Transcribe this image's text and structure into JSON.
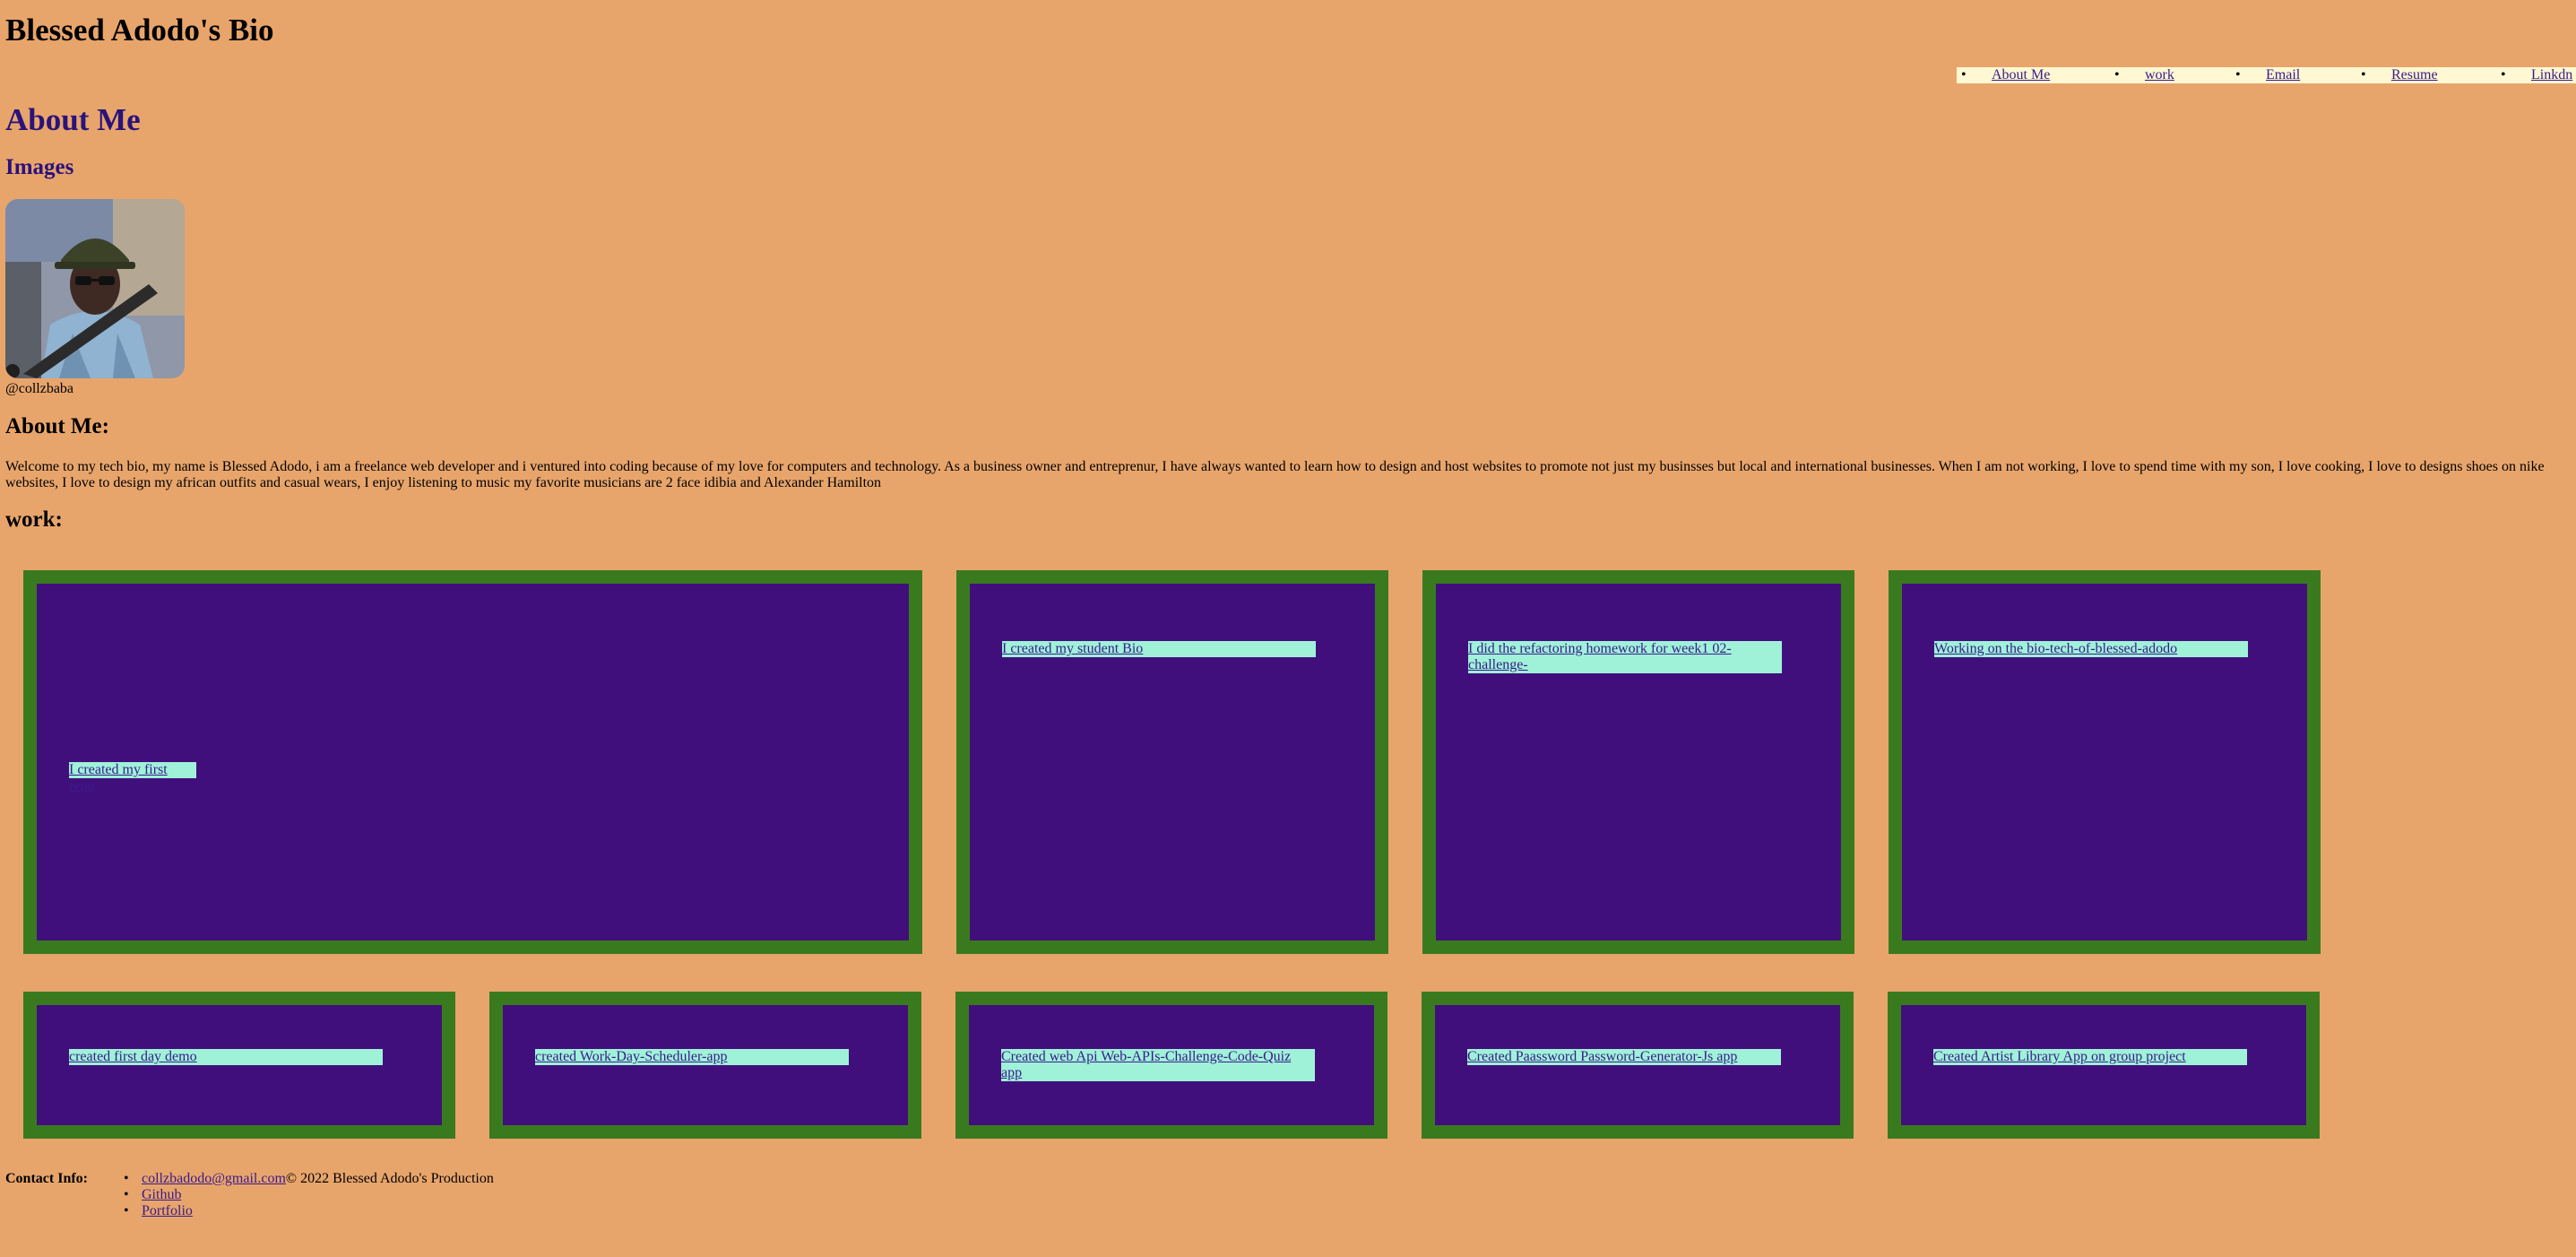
{
  "header": {
    "title": "Blessed Adodo's Bio"
  },
  "nav": {
    "items": [
      {
        "label": "About Me"
      },
      {
        "label": "work"
      },
      {
        "label": "Email"
      },
      {
        "label": "Resume"
      },
      {
        "label": "Linkdn"
      }
    ]
  },
  "about_section": {
    "title": "About Me",
    "images_heading": "Images",
    "handle": "@collzbaba",
    "heading": "About Me:",
    "bio": "Welcome to my tech bio, my name is Blessed Adodo, i am a freelance web developer and i ventured into coding because of my love for computers and technology. As a business owner and entreprenur, I have always wanted to learn how to design and host websites to promote not just my businsses but local and international businesses. When I am not working, I love to spend time with my son, I love cooking, I love to designs shoes on nike websites, I love to design my african outfits and casual wears, I enjoy listening to music my favorite musicians are 2 face idibia and Alexander Hamilton"
  },
  "work": {
    "heading": "work:",
    "row1": [
      {
        "label": "I created my first repo"
      },
      {
        "label": "I created my student Bio"
      },
      {
        "label": "I did the refactoring homework for week1 02-challenge-"
      },
      {
        "label": "Working on the bio-tech-of-blessed-adodo"
      }
    ],
    "row2": [
      {
        "label": "created first day demo"
      },
      {
        "label": "created Work-Day-Scheduler-app"
      },
      {
        "label": "Created web Api Web-APIs-Challenge-Code-Quiz app"
      },
      {
        "label": "Created Paassword Password-Generator-Js app"
      },
      {
        "label": "Created Artist Library App on group project"
      }
    ]
  },
  "footer": {
    "contact_label": "Contact Info:",
    "links": [
      {
        "label": "collzbadodo@gmail.com"
      },
      {
        "label": "Github"
      },
      {
        "label": "Portfolio"
      }
    ],
    "copyright": "© 2022 Blessed Adodo's Production"
  },
  "colors": {
    "page_background": "#e8a56b",
    "nav_background": "#fff8d2",
    "heading_color": "#2a137a",
    "card_background": "#410f7c",
    "card_border": "#3a7a1f",
    "link_background": "#9ff2d8"
  }
}
